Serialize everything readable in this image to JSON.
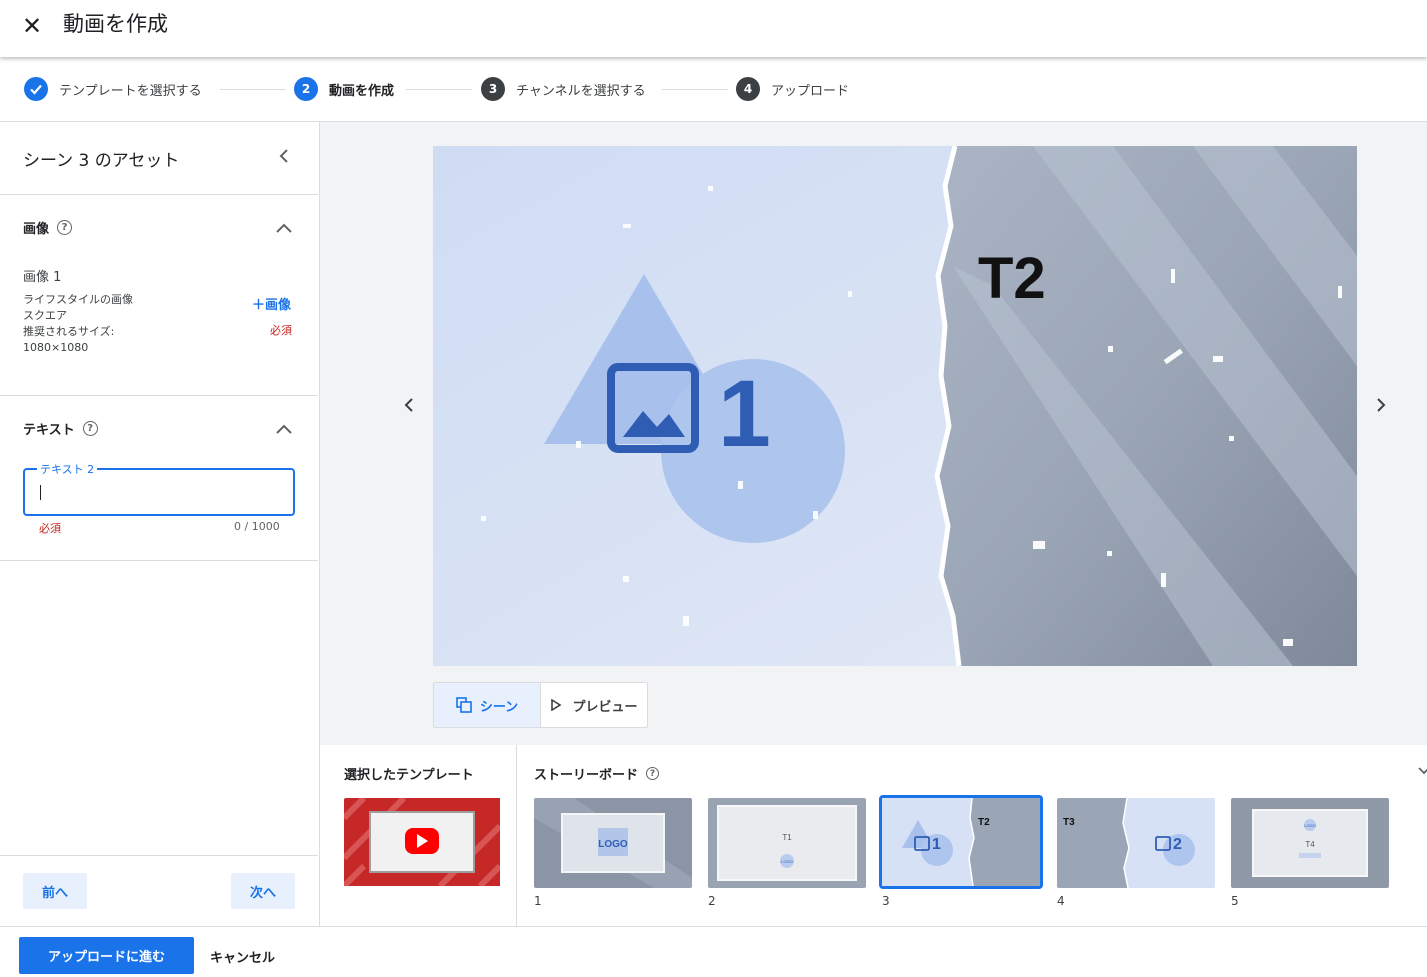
{
  "header": {
    "title": "動画を作成"
  },
  "stepper": [
    {
      "number": "",
      "label": "テンプレートを選択する",
      "state": "done"
    },
    {
      "number": "2",
      "label": "動画を作成",
      "state": "active"
    },
    {
      "number": "3",
      "label": "チャンネルを選択する",
      "state": "todo"
    },
    {
      "number": "4",
      "label": "アップロード",
      "state": "todo"
    }
  ],
  "panel": {
    "title": "シーン 3 のアセット",
    "image_section": {
      "title": "画像",
      "help": "?",
      "item_label": "画像 1",
      "desc_lines": [
        "ライフスタイルの画像",
        "スクエア",
        "推奨されるサイズ:",
        "1080×1080"
      ],
      "add_label": "＋画像",
      "required": "必須"
    },
    "text_section": {
      "title": "テキスト",
      "help": "?",
      "field_label": "テキスト 2",
      "value": "",
      "required": "必須",
      "counter": "0 / 1000"
    },
    "prev_label": "前へ",
    "next_label": "次へ"
  },
  "preview": {
    "placeholder_number": "1",
    "overlay_text": "T2",
    "toggle": {
      "scene_label": "シーン",
      "preview_label": "プレビュー"
    }
  },
  "template_section": {
    "title": "選択したテンプレート"
  },
  "storyboard": {
    "title": "ストーリーボード",
    "help": "?",
    "scenes": [
      {
        "number": "1",
        "text": "LOGO"
      },
      {
        "number": "2",
        "text": "T1",
        "sub": "LOGO"
      },
      {
        "number": "3",
        "text": "T2",
        "placeholder": "1"
      },
      {
        "number": "4",
        "text": "T3",
        "placeholder": "2"
      },
      {
        "number": "5",
        "text": "T4",
        "sub": "LOGO"
      }
    ]
  },
  "footer": {
    "primary_label": "アップロードに進む",
    "cancel_label": "キャンセル"
  },
  "colors": {
    "accent": "#1a73e8",
    "required": "#c5221f",
    "step_todo": "#3c4043"
  }
}
